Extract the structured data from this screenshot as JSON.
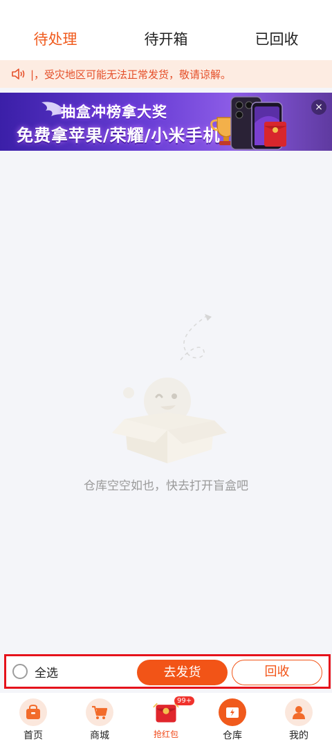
{
  "tabs": [
    {
      "label": "待处理",
      "active": true
    },
    {
      "label": "待开箱",
      "active": false
    },
    {
      "label": "已回收",
      "active": false
    }
  ],
  "notice": {
    "text": "|，受灾地区可能无法正常发货，敬请谅解。",
    "icon": "speaker-icon"
  },
  "banner": {
    "line1": "抽盒冲榜拿大奖",
    "line2": "免费拿苹果/荣耀/小米手机",
    "close_label": "×"
  },
  "empty": {
    "text": "仓库空空如也，快去打开盲盒吧"
  },
  "actions": {
    "select_all": "全选",
    "ship": "去发货",
    "recycle": "回收"
  },
  "nav": [
    {
      "label": "首页",
      "icon": "home-icon"
    },
    {
      "label": "商城",
      "icon": "cart-icon"
    },
    {
      "label": "抢红包",
      "icon": "red-envelope-icon",
      "badge": "99+"
    },
    {
      "label": "仓库",
      "icon": "warehouse-icon"
    },
    {
      "label": "我的",
      "icon": "user-icon"
    }
  ],
  "colors": {
    "accent": "#f05a1c",
    "highlight": "#e5121b"
  }
}
